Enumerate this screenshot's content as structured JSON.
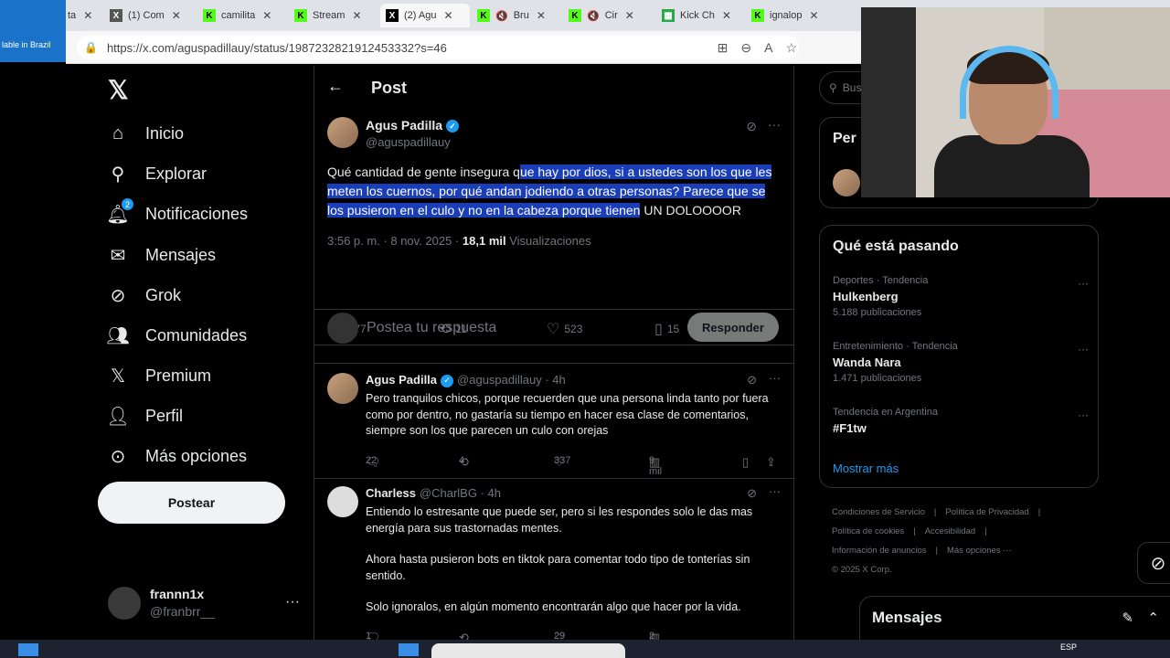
{
  "browser": {
    "side_label": "lable in Brazil",
    "tabs": [
      {
        "label": "ta",
        "icon": "twitch-icon"
      },
      {
        "label": "(1) Com",
        "icon": "x-icon"
      },
      {
        "label": "camilita",
        "icon": "kick-icon"
      },
      {
        "label": "Stream",
        "icon": "kick-icon"
      },
      {
        "label": "(2) Agu",
        "icon": "x-icon"
      },
      {
        "label": "Bru",
        "icon": "kick-icon"
      },
      {
        "label": "Cir",
        "icon": "kick-icon"
      },
      {
        "label": "Kick Ch",
        "icon": "kick-chat-icon"
      },
      {
        "label": "ignalop",
        "icon": "kick-icon"
      }
    ],
    "url": "https://x.com/aguspadillauy/status/1987232821912453332?s=46"
  },
  "nav": {
    "items": [
      {
        "label": "Inicio",
        "icon": "home-icon"
      },
      {
        "label": "Explorar",
        "icon": "search-icon"
      },
      {
        "label": "Notificaciones",
        "icon": "bell-icon",
        "badge": "2"
      },
      {
        "label": "Mensajes",
        "icon": "mail-icon"
      },
      {
        "label": "Grok",
        "icon": "grok-icon"
      },
      {
        "label": "Comunidades",
        "icon": "communities-icon"
      },
      {
        "label": "Premium",
        "icon": "x-icon"
      },
      {
        "label": "Perfil",
        "icon": "profile-icon"
      },
      {
        "label": "Más opciones",
        "icon": "more-circle-icon"
      }
    ],
    "post_button": "Postear",
    "account": {
      "name": "frannn1x",
      "handle": "@franbrr__"
    }
  },
  "header": {
    "title": "Post"
  },
  "post": {
    "author": "Agus Padilla",
    "handle": "@aguspadillauy",
    "text_plain_start": "Qué cantidad de gente insegura q",
    "text_highlighted": "ue hay por dios, si a ustedes son los que les meten los cuernos, por qué andan jodiendo a otras personas? Parece que se los pusieron en el culo y no en la cabeza porque tienen",
    "text_plain_end": " UN DOLOOOOR",
    "time": "3:56 p. m. · 8 nov. 2025 · ",
    "views": "18,1 mil",
    "views_label": " Visualizaciones",
    "stats": {
      "replies": "77",
      "reposts": "11",
      "likes": "523",
      "bookmarks": "15"
    }
  },
  "reply_box": {
    "placeholder": "Postea tu respuesta",
    "button": "Responder"
  },
  "replies": [
    {
      "name": "Agus Padilla",
      "handle": "@aguspadillauy · 4h",
      "text": "Pero tranquilos chicos, porque recuerden que una persona linda tanto por fuera como por dentro, no gastaría su tiempo en hacer esa clase de comentarios, siempre son los que parecen un culo con orejas",
      "replies": "22",
      "reposts": "4",
      "likes": "337",
      "views": "9 mil"
    },
    {
      "name": "Charless",
      "handle": "@CharlBG · 4h",
      "text_p1": "Entiendo lo estresante que puede ser, pero si les respondes solo le das mas energía para sus trastornadas mentes.",
      "text_p2": "Ahora hasta pusieron bots en tiktok para comentar todo tipo de tonterías sin sentido.",
      "text_p3": "Solo ignoralos, en algún momento encontrarán algo que hacer por la vida.",
      "replies": "1",
      "likes": "29",
      "views": "2 mil"
    }
  ],
  "sidebar": {
    "search_placeholder": "Bus",
    "persons_title": "Per",
    "trends_title": "Qué está pasando",
    "trends": [
      {
        "category": "Deportes · Tendencia",
        "name": "Hulkenberg",
        "count": "5.188 publicaciones"
      },
      {
        "category": "Entretenimiento · Tendencia",
        "name": "Wanda Nara",
        "count": "1.471 publicaciones"
      },
      {
        "category": "Tendencia en Argentina",
        "name": "#F1tw",
        "count": ""
      }
    ],
    "show_more": "Mostrar más",
    "footer": [
      "Condiciones de Servicio",
      "|",
      "Política de Privacidad",
      "|",
      "Política de cookies",
      "|",
      "Accesibilidad",
      "|",
      "Información de anuncios",
      "|",
      "Más opciones ···",
      "© 2025 X Corp."
    ]
  },
  "messages_drawer": {
    "title": "Mensajes"
  },
  "taskbar": {
    "lang": "ESP"
  }
}
